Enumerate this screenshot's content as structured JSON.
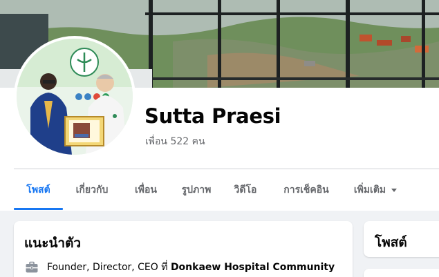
{
  "profile": {
    "name": "Sutta Praesi",
    "friends_label": "เพื่อน 522 คน"
  },
  "tabs": [
    {
      "label": "โพสต์",
      "active": true
    },
    {
      "label": "เกี่ยวกับ",
      "active": false
    },
    {
      "label": "เพื่อน",
      "active": false
    },
    {
      "label": "รูปภาพ",
      "active": false
    },
    {
      "label": "วิดีโอ",
      "active": false
    },
    {
      "label": "การเช็คอิน",
      "active": false
    },
    {
      "label": "เพิ่มเติม",
      "active": false
    }
  ],
  "intro": {
    "title": "แนะนำตัว",
    "work_prefix": "Founder, Director, CEO ที่",
    "work_place": "Donkaew Hospital Community",
    "icon": "briefcase-icon"
  },
  "posts_card": {
    "title": "โพสต์"
  },
  "colors": {
    "accent": "#1877f2",
    "secondary_text": "#65676b",
    "background": "#f0f2f5"
  }
}
